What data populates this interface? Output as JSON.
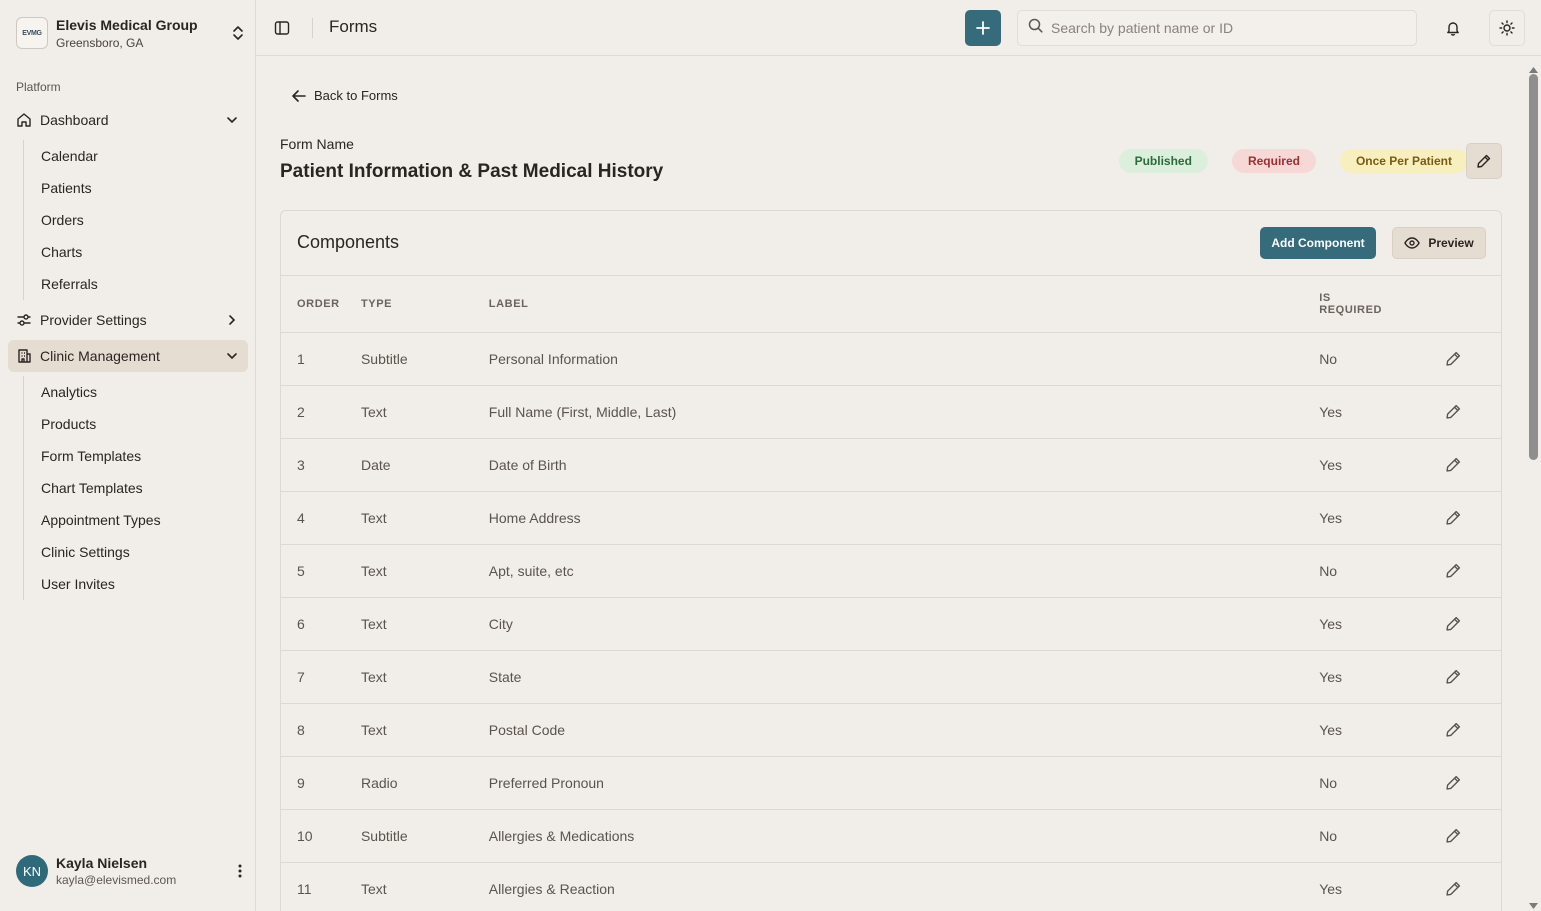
{
  "org": {
    "logo_text": "EVMG",
    "name": "Elevis Medical Group",
    "location": "Greensboro, GA"
  },
  "sidebar": {
    "section_label": "Platform",
    "dashboard": {
      "label": "Dashboard",
      "items": [
        "Calendar",
        "Patients",
        "Orders",
        "Charts",
        "Referrals"
      ]
    },
    "provider_settings": {
      "label": "Provider Settings"
    },
    "clinic_management": {
      "label": "Clinic Management",
      "items": [
        "Analytics",
        "Products",
        "Form Templates",
        "Chart Templates",
        "Appointment Types",
        "Clinic Settings",
        "User Invites"
      ]
    }
  },
  "user": {
    "initials": "KN",
    "name": "Kayla Nielsen",
    "email": "kayla@elevismed.com"
  },
  "header": {
    "title": "Forms",
    "search_placeholder": "Search by patient name or ID"
  },
  "form": {
    "back_label": "Back to Forms",
    "name_label": "Form Name",
    "title": "Patient Information & Past Medical History",
    "badges": {
      "published": "Published",
      "required": "Required",
      "once": "Once Per Patient"
    }
  },
  "components": {
    "title": "Components",
    "add_label": "Add Component",
    "preview_label": "Preview",
    "columns": {
      "order": "ORDER",
      "type": "TYPE",
      "label": "LABEL",
      "required_line1": "IS",
      "required_line2": "REQUIRED"
    },
    "rows": [
      {
        "order": "1",
        "type": "Subtitle",
        "label": "Personal Information",
        "required": "No"
      },
      {
        "order": "2",
        "type": "Text",
        "label": "Full Name (First, Middle, Last)",
        "required": "Yes"
      },
      {
        "order": "3",
        "type": "Date",
        "label": "Date of Birth",
        "required": "Yes"
      },
      {
        "order": "4",
        "type": "Text",
        "label": "Home Address",
        "required": "Yes"
      },
      {
        "order": "5",
        "type": "Text",
        "label": "Apt, suite, etc",
        "required": "No"
      },
      {
        "order": "6",
        "type": "Text",
        "label": "City",
        "required": "Yes"
      },
      {
        "order": "7",
        "type": "Text",
        "label": "State",
        "required": "Yes"
      },
      {
        "order": "8",
        "type": "Text",
        "label": "Postal Code",
        "required": "Yes"
      },
      {
        "order": "9",
        "type": "Radio",
        "label": "Preferred Pronoun",
        "required": "No"
      },
      {
        "order": "10",
        "type": "Subtitle",
        "label": "Allergies & Medications",
        "required": "No"
      },
      {
        "order": "11",
        "type": "Text",
        "label": "Allergies & Reaction",
        "required": "Yes"
      }
    ]
  },
  "colors": {
    "accent": "#356b7b",
    "background": "#f1ede8",
    "active_nav": "#e6ddd2"
  }
}
